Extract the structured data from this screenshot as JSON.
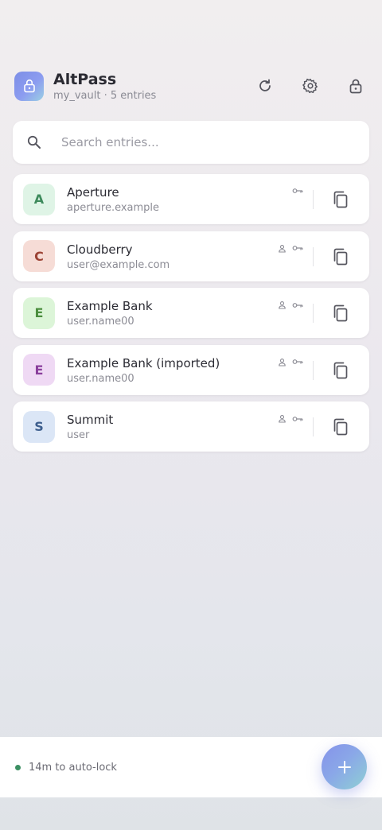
{
  "header": {
    "title": "AltPass",
    "subtitle": "my_vault · 5 entries",
    "logo_icon": "lock-icon",
    "actions": [
      {
        "icon": "refresh-icon"
      },
      {
        "icon": "gear-icon"
      },
      {
        "icon": "lock-icon"
      }
    ]
  },
  "search": {
    "placeholder": "Search entries...",
    "value": ""
  },
  "entries": [
    {
      "initial": "A",
      "name": "Aperture",
      "sub": "aperture.example",
      "avatar_bg": "#dff4e6",
      "avatar_fg": "#3e8a5c",
      "has_user": false,
      "has_password": true
    },
    {
      "initial": "C",
      "name": "Cloudberry",
      "sub": "user@example.com",
      "avatar_bg": "#f6dcd6",
      "avatar_fg": "#9c4335",
      "has_user": true,
      "has_password": true
    },
    {
      "initial": "E",
      "name": "Example Bank",
      "sub": "user.name00",
      "avatar_bg": "#dcf5d8",
      "avatar_fg": "#4b8e3e",
      "has_user": true,
      "has_password": true
    },
    {
      "initial": "E",
      "name": "Example Bank (imported)",
      "sub": "user.name00",
      "avatar_bg": "#efd9f4",
      "avatar_fg": "#8a3e9c",
      "has_user": true,
      "has_password": true
    },
    {
      "initial": "S",
      "name": "Summit",
      "sub": "user",
      "avatar_bg": "#dbe6f6",
      "avatar_fg": "#3e5f8e",
      "has_user": true,
      "has_password": true
    }
  ],
  "footer": {
    "status_text": "14m to auto-lock",
    "status_color": "#3b8f62",
    "fab_icon": "plus-icon"
  },
  "colors": {
    "accent": "#8592ea",
    "card_bg": "#ffffff"
  }
}
